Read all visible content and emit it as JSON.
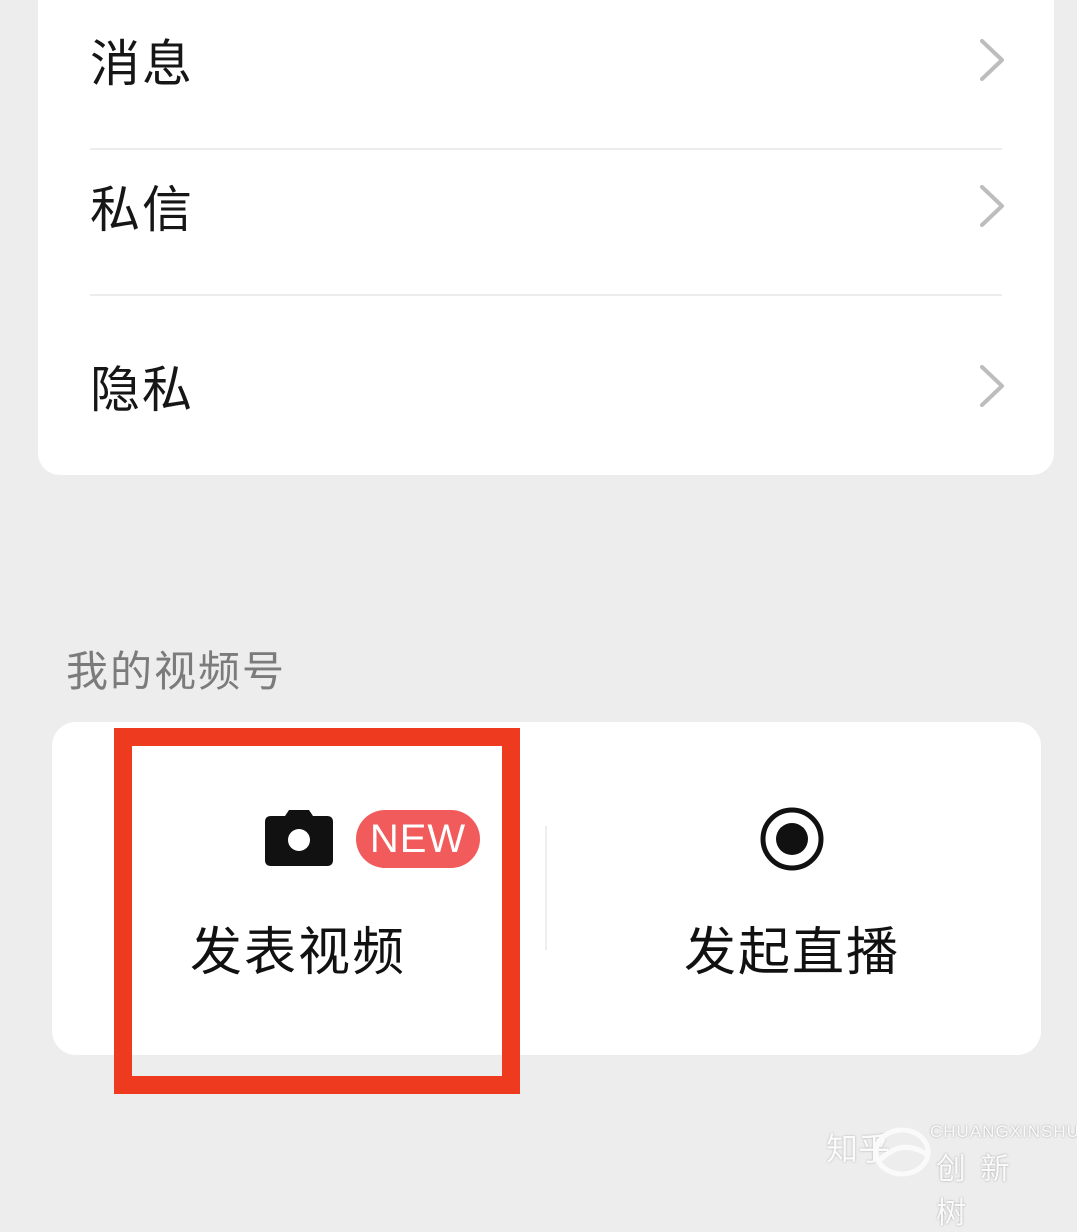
{
  "settings": {
    "items": [
      {
        "label": "消息"
      },
      {
        "label": "私信"
      },
      {
        "label": "隐私"
      }
    ]
  },
  "channels": {
    "section_title": "我的视频号",
    "publish_video": {
      "label": "发表视频",
      "badge": "NEW",
      "icon": "camera-icon"
    },
    "start_live": {
      "label": "发起直播",
      "icon": "record-icon"
    }
  },
  "watermark": {
    "zhihu": "知乎",
    "pinyin": "CHUANGXINSHU",
    "chinese": "创新树"
  },
  "colors": {
    "background": "#ededed",
    "card": "#ffffff",
    "highlight": "#ee3a1f",
    "badge": "#f25b5b",
    "section_title": "#7b7b7b"
  }
}
